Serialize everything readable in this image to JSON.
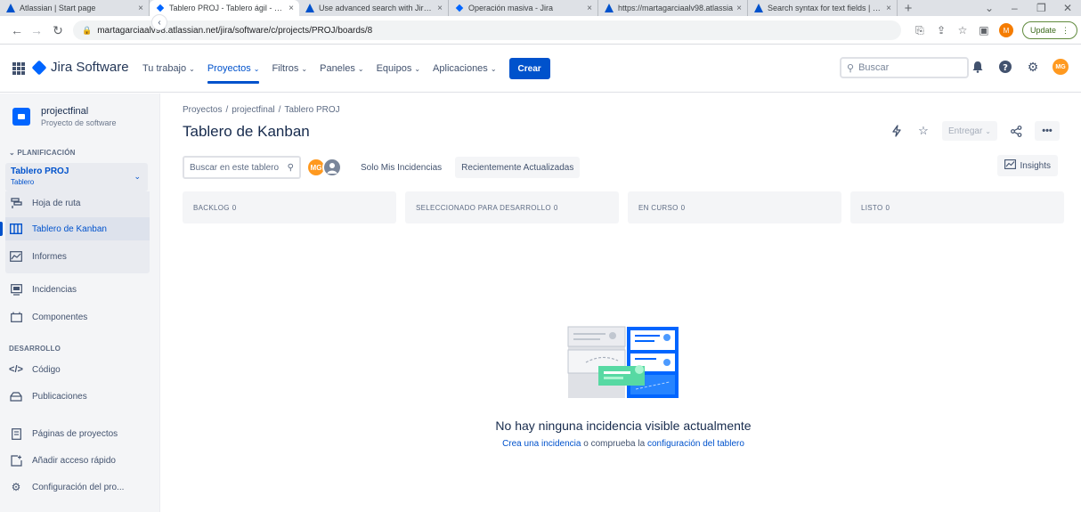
{
  "browser": {
    "tabs": [
      {
        "title": "Atlassian | Start page",
        "active": false
      },
      {
        "title": "Tablero PROJ - Tablero ágil - Jira",
        "active": true
      },
      {
        "title": "Use advanced search with Jira Cl",
        "active": false
      },
      {
        "title": "Operación masiva - Jira",
        "active": false
      },
      {
        "title": "https://martagarciaalv98.atlassia",
        "active": false
      },
      {
        "title": "Search syntax for text fields | Jira",
        "active": false
      }
    ],
    "close_glyph": "×",
    "new_tab": "+",
    "url": "martagarciaalv98.atlassian.net/jira/software/c/projects/PROJ/boards/8",
    "profile_initial": "M",
    "update_label": "Update"
  },
  "topnav": {
    "product": "Jira Software",
    "menu": [
      {
        "label": "Tu trabajo",
        "active": false
      },
      {
        "label": "Proyectos",
        "active": true
      },
      {
        "label": "Filtros",
        "active": false
      },
      {
        "label": "Paneles",
        "active": false
      },
      {
        "label": "Equipos",
        "active": false
      },
      {
        "label": "Aplicaciones",
        "active": false
      }
    ],
    "create_label": "Crear",
    "search_placeholder": "Buscar",
    "avatar_initials": "MG"
  },
  "sidebar": {
    "project_name": "projectfinal",
    "project_type": "Proyecto de software",
    "planning_header": "PLANIFICACIÓN",
    "board_selector": {
      "title": "Tablero PROJ",
      "subtitle": "Tablero"
    },
    "planning_items": [
      {
        "label": "Hoja de ruta",
        "icon": "roadmap-icon"
      },
      {
        "label": "Tablero de Kanban",
        "icon": "board-icon",
        "active": true
      },
      {
        "label": "Informes",
        "icon": "reports-icon"
      }
    ],
    "issues_items": [
      {
        "label": "Incidencias",
        "icon": "issues-icon"
      },
      {
        "label": "Componentes",
        "icon": "components-icon"
      }
    ],
    "dev_header": "DESARROLLO",
    "dev_items": [
      {
        "label": "Código",
        "icon": "code-icon"
      },
      {
        "label": "Publicaciones",
        "icon": "releases-icon"
      }
    ],
    "bottom_items": [
      {
        "label": "Páginas de proyectos",
        "icon": "pages-icon"
      },
      {
        "label": "Añadir acceso rápido",
        "icon": "add-shortcut-icon"
      },
      {
        "label": "Configuración del pro...",
        "icon": "settings-icon"
      }
    ]
  },
  "main": {
    "breadcrumbs": [
      "Proyectos",
      "projectfinal",
      "Tablero PROJ"
    ],
    "title": "Tablero de Kanban",
    "release_label": "Entregar",
    "search_placeholder": "Buscar en este tablero",
    "avatar_initials": "MG",
    "quick_filters": [
      "Solo Mis Incidencias",
      "Recientemente Actualizadas"
    ],
    "insights_label": "Insights",
    "columns": [
      {
        "name": "BACKLOG",
        "count": "0"
      },
      {
        "name": "SELECCIONADO PARA DESARROLLO",
        "count": "0"
      },
      {
        "name": "EN CURSO",
        "count": "0"
      },
      {
        "name": "LISTO",
        "count": "0"
      }
    ],
    "empty_title": "No hay ninguna incidencia visible actualmente",
    "empty_link1": "Crea una incidencia",
    "empty_middle": " o comprueba la ",
    "empty_link2": "configuración del tablero"
  },
  "colors": {
    "accent": "#0052cc",
    "avatar": "#ff991f",
    "sidebar_bg": "#f4f5f7"
  }
}
